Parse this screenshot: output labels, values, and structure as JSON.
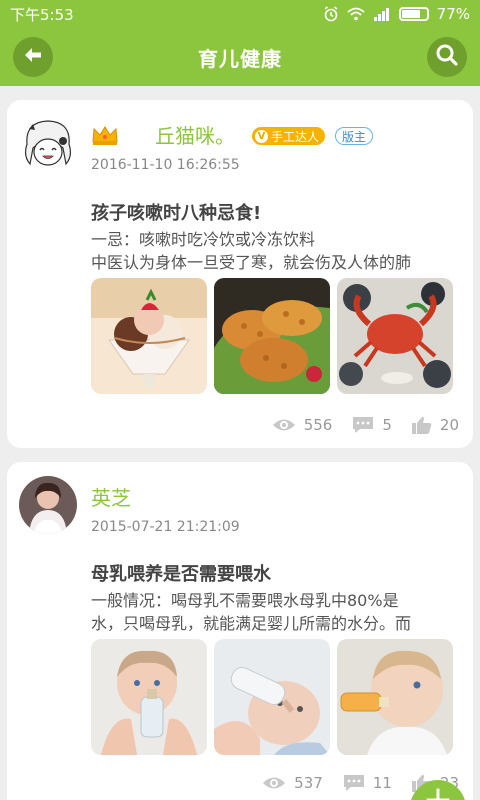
{
  "status_bar": {
    "time": "下午5:53",
    "battery_percent": "77%",
    "battery_level": 0.77,
    "icons": [
      "alarm-icon",
      "wifi-icon",
      "signal-icon",
      "battery-icon"
    ]
  },
  "header": {
    "title": "育儿健康",
    "back_icon": "arrow-left-icon",
    "search_icon": "search-icon",
    "bg_color": "#8cc63f"
  },
  "posts": [
    {
      "user": "丘猫咪。",
      "badges": [
        "手工达人",
        "版主"
      ],
      "badge_icon": "crown-icon",
      "date": "2016-11-10 16:26:55",
      "title": "孩子咳嗽时八种忌食!",
      "excerpt": [
        "一忌：咳嗽时吃冷饮或冷冻饮料",
        "中医认为身体一旦受了寒，就会伤及人体的肺"
      ],
      "images": [
        "ice-cream-photo",
        "fried-food-photo",
        "seafood-crab-photo"
      ],
      "views": "556",
      "comments": "5",
      "likes": "20"
    },
    {
      "user": "英芝",
      "date": "2015-07-21 21:21:09",
      "title": "母乳喂养是否需要喂水",
      "excerpt": [
        "一般情况：喝母乳不需要喂水母乳中80%是",
        "水，只喝母乳，就能满足婴儿所需的水分。而"
      ],
      "images": [
        "baby-bottle-photo-1",
        "baby-bottle-photo-2",
        "baby-bottle-photo-3"
      ],
      "views": "537",
      "comments": "11",
      "likes": "23"
    }
  ],
  "fab": {
    "label": "+"
  },
  "colors": {
    "accent": "#8cc63f",
    "accent_dark": "#6f9f2c",
    "gold": "#f5b300"
  }
}
